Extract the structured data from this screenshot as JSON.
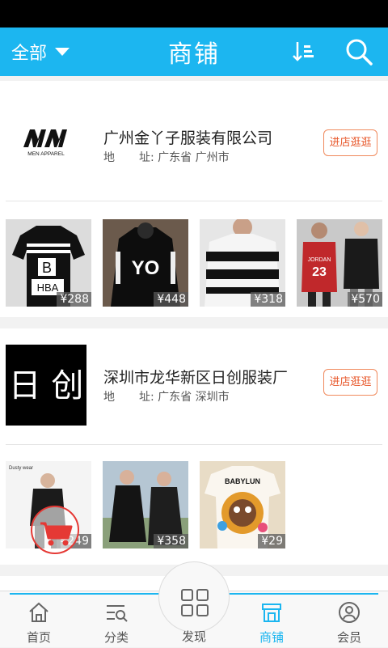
{
  "header": {
    "filter_label": "全部",
    "title": "商铺"
  },
  "shops": [
    {
      "name": "广州金丫子服装有限公司",
      "addr_key_1": "地",
      "addr_key_2": "址:",
      "address": "广东省 广州市",
      "visit_label": "进店逛逛",
      "logo_text": "MEN APPAREL",
      "products": [
        {
          "price": "¥288"
        },
        {
          "price": "¥448"
        },
        {
          "price": "¥318"
        },
        {
          "price": "¥570"
        }
      ]
    },
    {
      "name": "深圳市龙华新区日创服装厂",
      "addr_key_1": "地",
      "addr_key_2": "址:",
      "address": "广东省 深圳市",
      "visit_label": "进店逛逛",
      "logo_text": "日 创",
      "products": [
        {
          "price": "¥249"
        },
        {
          "price": "¥358"
        },
        {
          "price": "¥29"
        }
      ]
    }
  ],
  "product_prints": {
    "p1_b": "B",
    "p1_hba": "HBA",
    "p2_yo": "YO",
    "p4_23": "23",
    "p4_jordan": "JORDAN",
    "p7_babylun": "BABYLUN",
    "p5_brand": "Dusty wear"
  },
  "tabs": [
    {
      "label": "首页",
      "icon": "home-icon"
    },
    {
      "label": "分类",
      "icon": "category-list-icon"
    },
    {
      "label": "发现",
      "icon": "grid-icon"
    },
    {
      "label": "商铺",
      "icon": "store-icon"
    },
    {
      "label": "会员",
      "icon": "user-icon"
    }
  ],
  "colors": {
    "brand": "#1cb6f0",
    "visit_button": "#e8572a",
    "cart_fab": "#e53935"
  }
}
